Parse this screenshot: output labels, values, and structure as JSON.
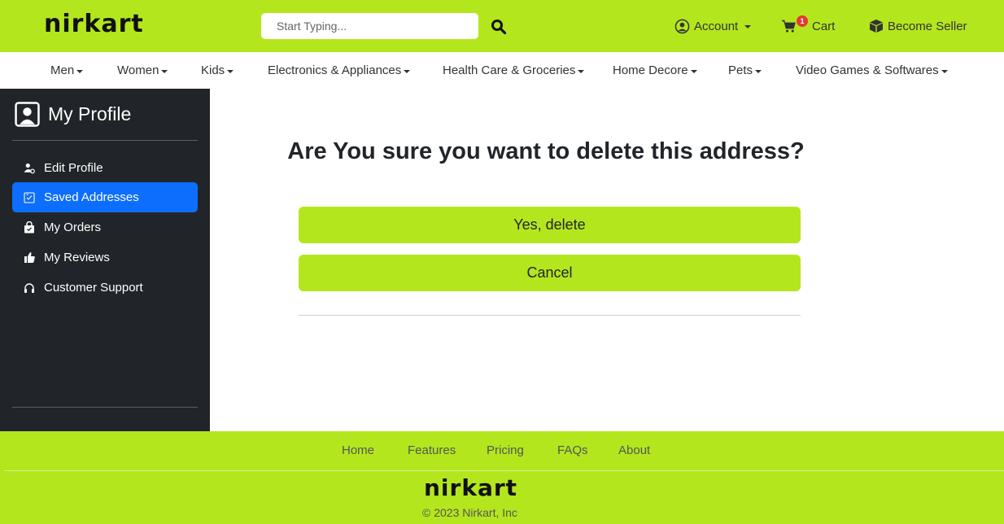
{
  "header": {
    "logo": "nirkart",
    "search_placeholder": "Start Typing...",
    "account_label": "Account",
    "cart_label": "Cart",
    "cart_count": "1",
    "seller_label": "Become Seller"
  },
  "categories": [
    {
      "label": "Men"
    },
    {
      "label": "Women"
    },
    {
      "label": "Kids"
    },
    {
      "label": "Electronics & Appliances"
    },
    {
      "label": "Health Care & Groceries"
    },
    {
      "label": "Home Decore"
    },
    {
      "label": "Pets"
    },
    {
      "label": "Video Games & Softwares"
    }
  ],
  "sidebar": {
    "title": "My Profile",
    "items": [
      {
        "label": "Edit Profile",
        "icon": "user-gear-icon"
      },
      {
        "label": "Saved Addresses",
        "icon": "checklist-icon",
        "active": true
      },
      {
        "label": "My Orders",
        "icon": "bag-icon"
      },
      {
        "label": "My Reviews",
        "icon": "thumbs-up-icon"
      },
      {
        "label": "Customer Support",
        "icon": "headset-icon"
      }
    ]
  },
  "main": {
    "title": "Are You sure you want to delete this address?",
    "confirm_label": "Yes, delete",
    "cancel_label": "Cancel"
  },
  "footer": {
    "links": [
      "Home",
      "Features",
      "Pricing",
      "FAQs",
      "About"
    ],
    "logo": "nirkart",
    "copyright": "© 2023 Nirkart, Inc"
  },
  "colors": {
    "brand": "#b4e61e",
    "sidebar_bg": "#212529",
    "active": "#0d6efd"
  }
}
